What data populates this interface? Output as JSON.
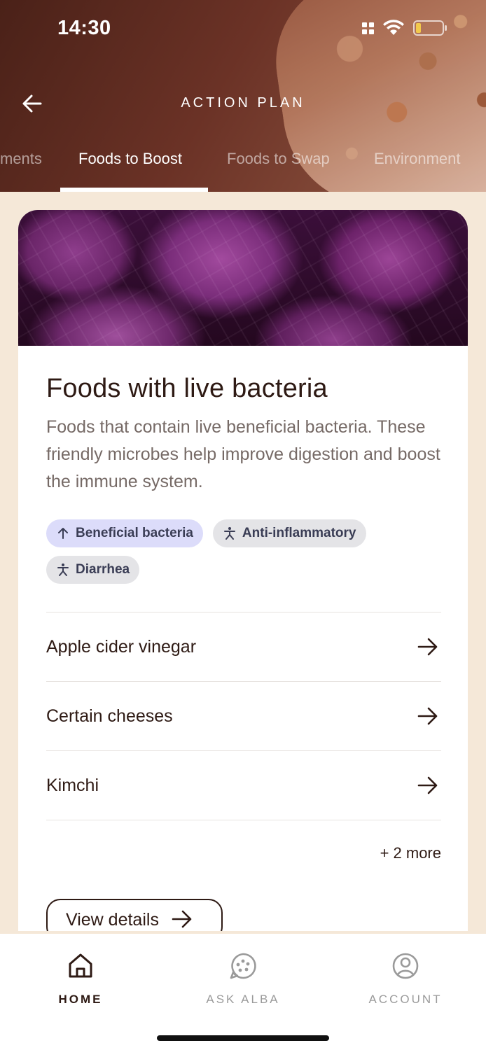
{
  "status_bar": {
    "time": "14:30"
  },
  "header": {
    "title": "ACTION PLAN"
  },
  "tabs": [
    {
      "label": "ments",
      "active": false
    },
    {
      "label": "Foods to Boost",
      "active": true
    },
    {
      "label": "Foods to Swap",
      "active": false
    },
    {
      "label": "Environment",
      "active": false
    }
  ],
  "card": {
    "title": "Foods with live bacteria",
    "description": "Foods that contain live beneficial bacteria. These friendly microbes help improve digestion and boost the immune system.",
    "tags": [
      {
        "label": "Beneficial bacteria",
        "icon": "arrow-up-icon"
      },
      {
        "label": "Anti-inflammatory",
        "icon": "person-icon"
      },
      {
        "label": "Diarrhea",
        "icon": "person-icon"
      }
    ],
    "foods": [
      {
        "name": "Apple cider vinegar"
      },
      {
        "name": "Certain cheeses"
      },
      {
        "name": "Kimchi"
      }
    ],
    "more_label": "+ 2 more",
    "view_details_label": "View details"
  },
  "bottom_nav": [
    {
      "label": "HOME",
      "icon": "home-icon",
      "active": true
    },
    {
      "label": "ASK ALBA",
      "icon": "chat-icon",
      "active": false
    },
    {
      "label": "ACCOUNT",
      "icon": "account-icon",
      "active": false
    }
  ],
  "colors": {
    "header_bg": "#6b3226",
    "page_bg": "#f5e8d8",
    "text_dark": "#2e1a14",
    "tag_beneficial_bg": "#dcdcfa",
    "tag_bg": "#e4e4e7"
  }
}
